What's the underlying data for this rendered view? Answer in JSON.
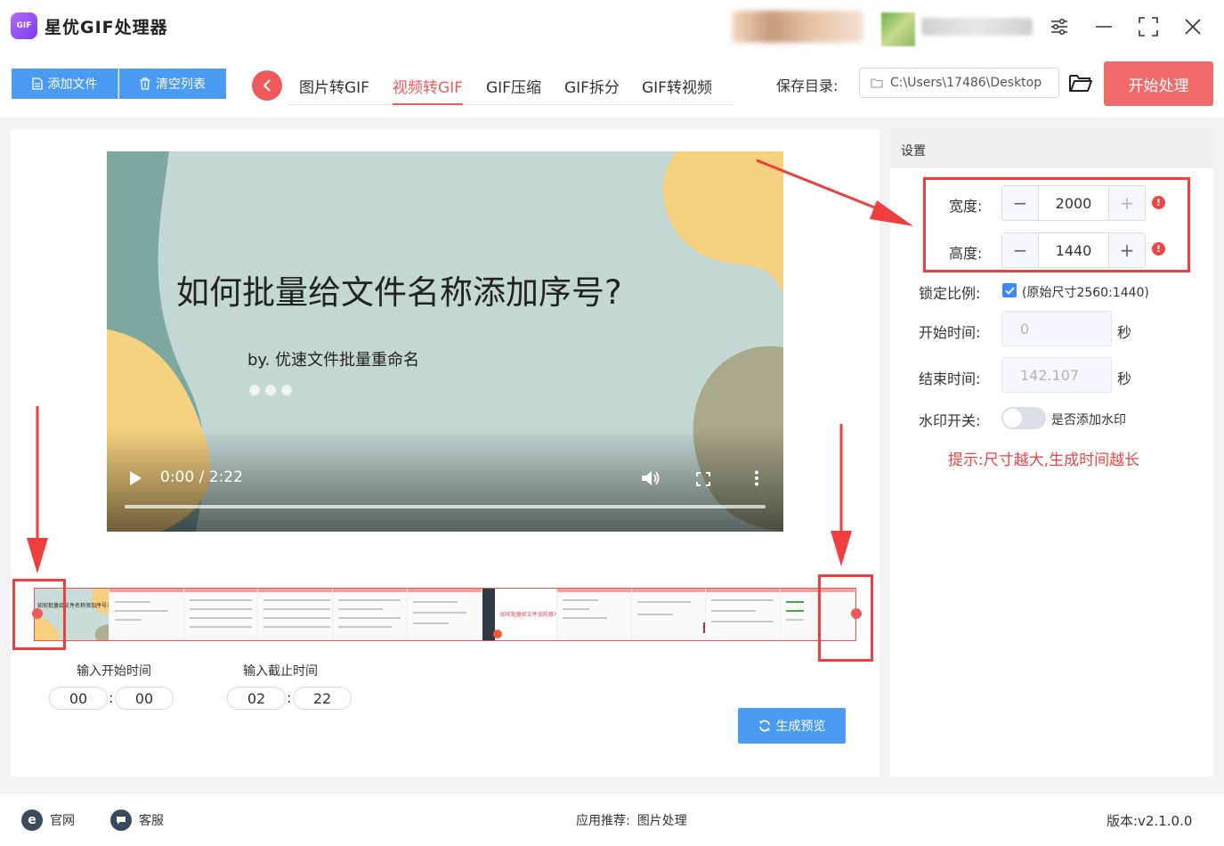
{
  "app": {
    "title": "星优GIF处理器",
    "logo_text": "GIF"
  },
  "window": {
    "controls": [
      "settings-icon",
      "minimize-icon",
      "maximize-icon",
      "close-icon"
    ]
  },
  "toolbar": {
    "add_file": "添加文件",
    "clear_list": "清空列表",
    "tabs": [
      {
        "label": "图片转GIF",
        "active": false
      },
      {
        "label": "视频转GIF",
        "active": true
      },
      {
        "label": "GIF压缩",
        "active": false
      },
      {
        "label": "GIF拆分",
        "active": false
      },
      {
        "label": "GIF转视频",
        "active": false
      }
    ],
    "save_label": "保存目录:",
    "save_path": "C:\\Users\\17486\\Desktop",
    "start": "开始处理"
  },
  "video": {
    "title": "如何批量给文件名称添加序号?",
    "subtitle": "by. 优速文件批量重命名",
    "time": "0:00 / 2:22"
  },
  "trim": {
    "start_label": "输入开始时间",
    "end_label": "输入截止时间",
    "start_min": "00",
    "start_sec": "00",
    "end_min": "02",
    "end_sec": "22",
    "preview_button": "生成预览",
    "frame_texts": [
      "如何批量给文件名称添加序号?",
      "如何批量给文件加前缀?"
    ]
  },
  "settings": {
    "header": "设置",
    "width_label": "宽度:",
    "width_value": "2000",
    "height_label": "高度:",
    "height_value": "1440",
    "lock_label": "锁定比例:",
    "lock_desc": "(原始尺寸2560:1440)",
    "lock_checked": true,
    "start_time_label": "开始时间:",
    "start_time_value": "0",
    "end_time_label": "结束时间:",
    "end_time_value": "142.107",
    "unit_seconds": "秒",
    "watermark_label": "水印开关:",
    "watermark_desc": "是否添加水印",
    "watermark_on": false,
    "hint": "提示:尺寸越大,生成时间越长"
  },
  "footer": {
    "website": "官网",
    "support": "客服",
    "recommend_label": "应用推荐:",
    "recommend_app": "图片处理",
    "version": "版本:v2.1.0.0"
  },
  "colors": {
    "accent_blue": "#4a9cf3",
    "accent_red": "#ee5a5a",
    "annotation_red": "#ee3e3e"
  }
}
